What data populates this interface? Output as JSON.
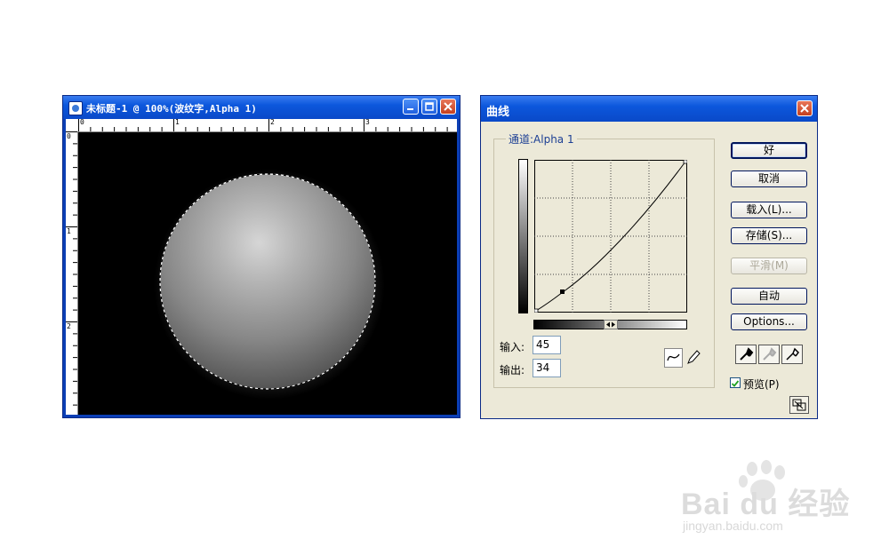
{
  "image_window": {
    "title": "未标题-1 @ 100%(波纹字,Alpha 1)",
    "ruler_top_numbers": [
      "0",
      "1",
      "2",
      "3"
    ],
    "ruler_left_numbers": [
      "0",
      "1",
      "2"
    ]
  },
  "curves_dialog": {
    "title": "曲线",
    "channel_label": "通道:Alpha 1",
    "input_label": "输入:",
    "input_value": "45",
    "output_label": "输出:",
    "output_value": "34",
    "buttons": {
      "ok": "好",
      "cancel": "取消",
      "load": "载入(L)...",
      "save": "存储(S)...",
      "smooth": "平滑(M)",
      "auto": "自动",
      "options": "Options..."
    },
    "preview_label": "预览(P)",
    "preview_checked": true,
    "curve_points": [
      {
        "input": 0,
        "output": 0
      },
      {
        "input": 45,
        "output": 34
      },
      {
        "input": 255,
        "output": 255
      }
    ]
  },
  "watermark": {
    "brand": "Bai du 经验",
    "url": "jingyan.baidu.com"
  },
  "colors": {
    "titlebar": "#0a49c8",
    "dialog_bg": "#ece9d8",
    "close_button": "#c43f1e"
  }
}
